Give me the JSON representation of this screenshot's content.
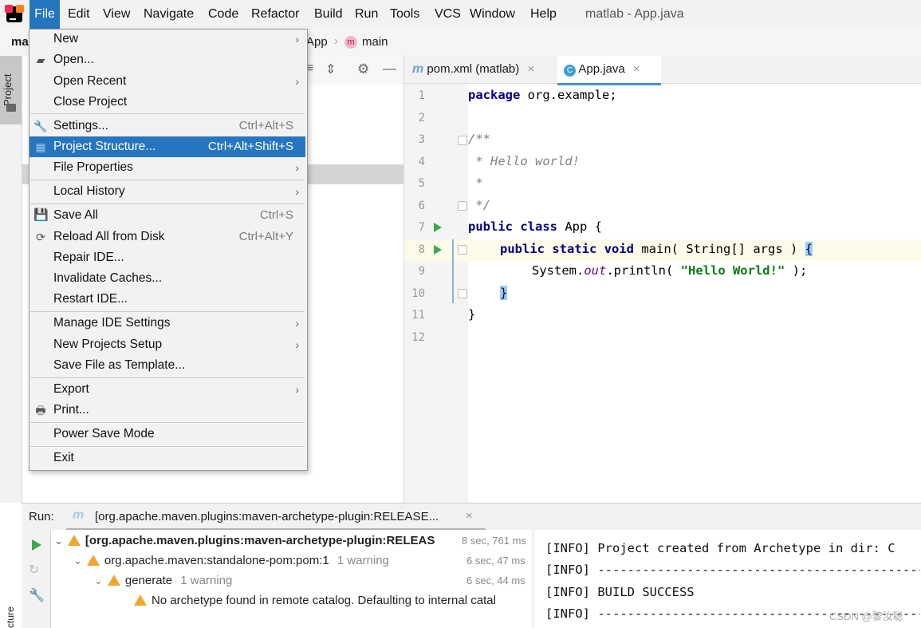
{
  "window_title": "matlab - App.java",
  "menubar": [
    "File",
    "Edit",
    "View",
    "Navigate",
    "Code",
    "Refactor",
    "Build",
    "Run",
    "Tools",
    "VCS",
    "Window",
    "Help"
  ],
  "breadcrumb": {
    "project": "ma",
    "class": "App",
    "method": "main",
    "method_icon": "m"
  },
  "project_tab": "Project",
  "editor_tabs": [
    {
      "label": "pom.xml (matlab)",
      "icon": "m"
    },
    {
      "label": "App.java",
      "icon": "C"
    }
  ],
  "line_numbers": [
    "1",
    "2",
    "3",
    "4",
    "5",
    "6",
    "7",
    "8",
    "9",
    "10",
    "11",
    "12"
  ],
  "code": {
    "l1_kw": "package",
    "l1_rest": " org.example;",
    "l3": "/**",
    "l4": " * Hello world!",
    "l5": " *",
    "l6": " */",
    "l7_kw1": "public",
    "l7_kw2": "class",
    "l7_rest": " App {",
    "l8_kw1": "public",
    "l8_kw2": "static",
    "l8_kw3": "void",
    "l8_rest": " main( String[] args ) ",
    "l8_brace": "{",
    "l9_a": "System.",
    "l9_out": "out",
    "l9_b": ".println( ",
    "l9_str": "\"Hello World!\"",
    "l9_c": " );",
    "l10_brace": "}",
    "l11": "}"
  },
  "file_menu": {
    "new": "New",
    "open": "Open...",
    "open_recent": "Open Recent",
    "close_project": "Close Project",
    "settings": "Settings...",
    "settings_sc": "Ctrl+Alt+S",
    "project_structure": "Project Structure...",
    "project_structure_sc": "Ctrl+Alt+Shift+S",
    "file_properties": "File Properties",
    "local_history": "Local History",
    "save_all": "Save All",
    "save_all_sc": "Ctrl+S",
    "reload": "Reload All from Disk",
    "reload_sc": "Ctrl+Alt+Y",
    "repair": "Repair IDE...",
    "invalidate": "Invalidate Caches...",
    "restart": "Restart IDE...",
    "manage_ide": "Manage IDE Settings",
    "new_projects_setup": "New Projects Setup",
    "save_template": "Save File as Template...",
    "export": "Export",
    "print": "Print...",
    "power_save": "Power Save Mode",
    "exit": "Exit"
  },
  "run_panel": {
    "label": "Run:",
    "tab": "[org.apache.maven.plugins:maven-archetype-plugin:RELEASE...",
    "tree": [
      {
        "text": "[org.apache.maven.plugins:maven-archetype-plugin:RELEAS",
        "time": "8 sec, 761 ms"
      },
      {
        "text": "org.apache.maven:standalone-pom:pom:1",
        "extra": "1 warning",
        "time": "6 sec, 47 ms"
      },
      {
        "text": "generate",
        "extra": "1 warning",
        "time": "6 sec, 44 ms"
      },
      {
        "text": "No archetype found in remote catalog. Defaulting to internal catal"
      }
    ],
    "console": [
      "[INFO] Project created from Archetype in dir: C",
      "[INFO] ------------------------------------------------",
      "[INFO] BUILD SUCCESS",
      "[INFO] ------------------------------------------------"
    ],
    "watermark": "CSDN @黎汝聪",
    "bottom_tab": "cture"
  },
  "colors": {
    "accent": "#2675bf",
    "run_green": "#3ba84d",
    "warning": "#f0a732"
  }
}
